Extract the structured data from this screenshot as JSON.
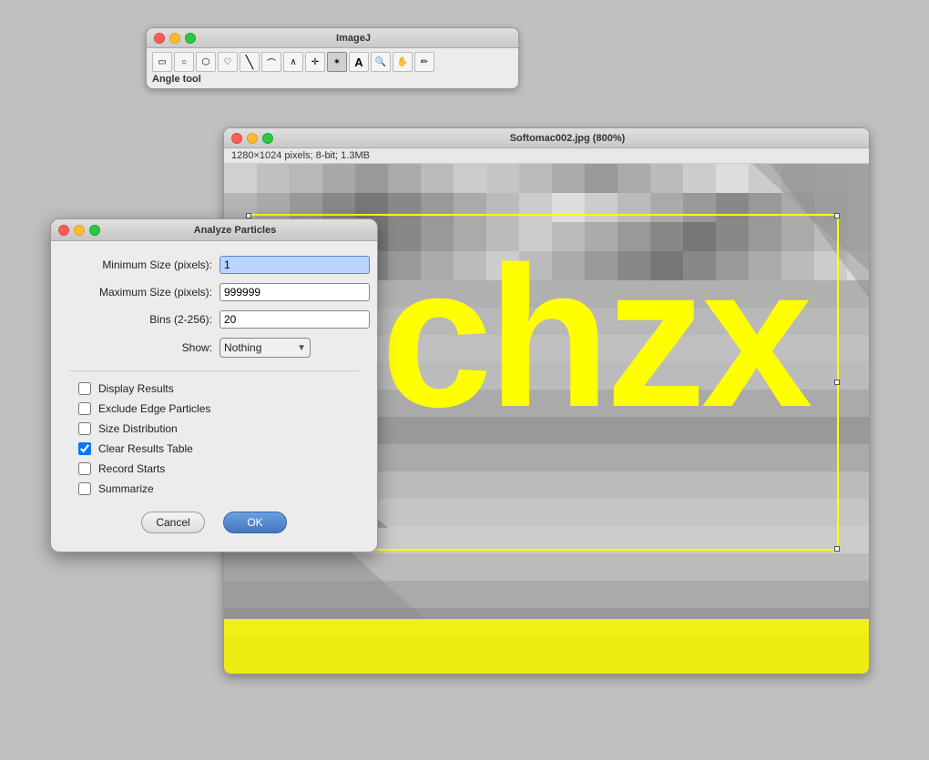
{
  "imagej_toolbar": {
    "title": "ImageJ",
    "status_label": "Angle tool",
    "tools": [
      {
        "name": "rectangle",
        "icon": "▭"
      },
      {
        "name": "oval",
        "icon": "○"
      },
      {
        "name": "polygon",
        "icon": "⬡"
      },
      {
        "name": "freehand",
        "icon": "♡"
      },
      {
        "name": "line",
        "icon": "╲"
      },
      {
        "name": "polyline",
        "icon": "∧"
      },
      {
        "name": "angle",
        "icon": "∧"
      },
      {
        "name": "crosshair",
        "icon": "✛"
      },
      {
        "name": "wand",
        "icon": "✶"
      },
      {
        "name": "text",
        "icon": "A"
      },
      {
        "name": "magnify",
        "icon": "⊕"
      },
      {
        "name": "hand",
        "icon": "✋"
      },
      {
        "name": "dropper",
        "icon": "✏"
      }
    ]
  },
  "image_window": {
    "title": "Softomac002.jpg (800%)",
    "info": "1280×1024 pixels; 8-bit; 1.3MB",
    "yellow_text": "j  chzx"
  },
  "analyze_dialog": {
    "title": "Analyze Particles",
    "fields": {
      "min_size_label": "Minimum Size (pixels):",
      "min_size_value": "1",
      "max_size_label": "Maximum Size (pixels):",
      "max_size_value": "999999",
      "bins_label": "Bins (2-256):",
      "bins_value": "20",
      "show_label": "Show:",
      "show_value": "Nothing"
    },
    "checkboxes": [
      {
        "label": "Display Results",
        "checked": false
      },
      {
        "label": "Exclude Edge Particles",
        "checked": false
      },
      {
        "label": "Size Distribution",
        "checked": false
      },
      {
        "label": "Clear Results Table",
        "checked": true
      },
      {
        "label": "Record Starts",
        "checked": false
      },
      {
        "label": "Summarize",
        "checked": false
      }
    ],
    "buttons": {
      "cancel": "Cancel",
      "ok": "OK"
    }
  }
}
